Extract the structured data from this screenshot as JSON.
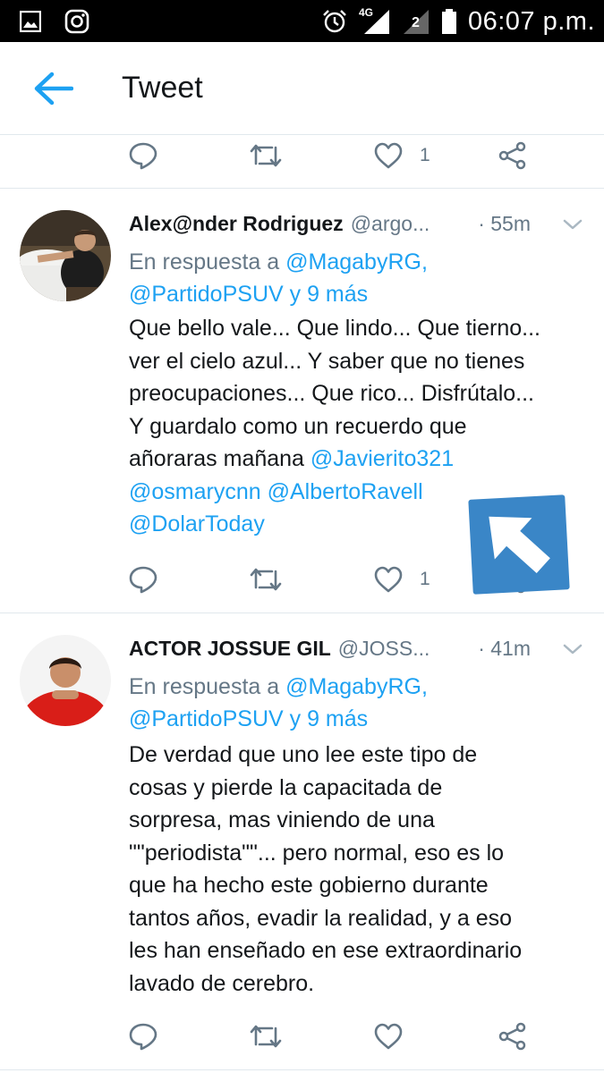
{
  "status_bar": {
    "network": "4G",
    "sim_slot": "2",
    "time": "06:07 p.m.",
    "icons": [
      "gallery-icon",
      "instagram-icon",
      "alarm-icon",
      "signal-icon",
      "battery-icon"
    ]
  },
  "header": {
    "title": "Tweet",
    "back_icon": "arrow-left-icon",
    "accent_color": "#1da1f2"
  },
  "top_actions": {
    "like_count": "1"
  },
  "tweets": [
    {
      "name": "Alex@nder Rodriguez",
      "handle": "@argo...",
      "time": "· 55m",
      "reply_prefix": "En respuesta a",
      "reply_to_1": "@MagabyRG,",
      "reply_to_2": "@PartidoPSUV",
      "reply_and": "y",
      "reply_more": "9 más",
      "text_lines": [
        "Que bello vale... Que lindo... Que tierno...",
        "ver el cielo azul... Y saber que no tienes",
        "preocupaciones... Que rico... Disfrútalo...",
        "Y guardalo como un recuerdo que",
        "añoraras mañana"
      ],
      "mentions": [
        "@Javierito321",
        "@osmarycnn",
        "@AlbertoRavell",
        "@DolarToday"
      ],
      "like_count": "1"
    },
    {
      "name": "ACTOR JOSSUE GIL",
      "handle": "@JOSS...",
      "time": "· 41m",
      "reply_prefix": "En respuesta a",
      "reply_to_1": "@MagabyRG,",
      "reply_to_2": "@PartidoPSUV",
      "reply_and": "y",
      "reply_more": "9 más",
      "text_lines": [
        "De verdad que uno lee este tipo de",
        "cosas y pierde la capacitada de",
        "sorpresa, mas viniendo de una",
        "\"\"periodista\"\"... pero normal, eso es lo",
        "que ha hecho este gobierno durante",
        "tantos años, evadir la realidad, y a eso",
        "les han enseñado en ese extraordinario",
        "lavado de cerebro."
      ],
      "like_count": ""
    }
  ]
}
